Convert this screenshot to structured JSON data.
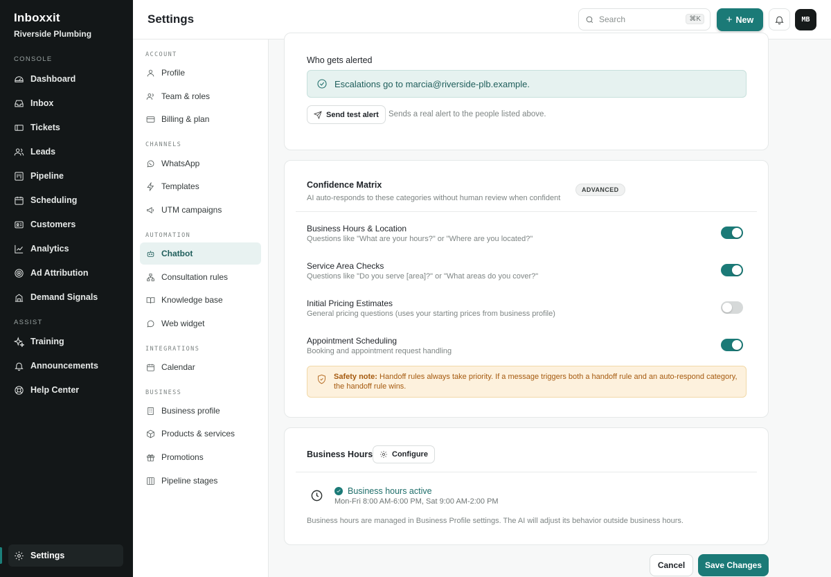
{
  "brand": {
    "name": "Inboxxit",
    "workspace": "Riverside Plumbing"
  },
  "sidebar": {
    "console_label": "CONSOLE",
    "console_items": [
      {
        "label": "Dashboard",
        "icon": "gauge-icon"
      },
      {
        "label": "Inbox",
        "icon": "inbox-icon"
      },
      {
        "label": "Tickets",
        "icon": "ticket-icon"
      },
      {
        "label": "Leads",
        "icon": "users-icon"
      },
      {
        "label": "Pipeline",
        "icon": "kanban-icon"
      },
      {
        "label": "Scheduling",
        "icon": "calendar-icon"
      },
      {
        "label": "Customers",
        "icon": "id-card-icon"
      },
      {
        "label": "Analytics",
        "icon": "chart-line-icon"
      },
      {
        "label": "Ad Attribution",
        "icon": "target-icon"
      },
      {
        "label": "Demand Signals",
        "icon": "building-icon"
      }
    ],
    "assist_label": "ASSIST",
    "assist_items": [
      {
        "label": "Training",
        "icon": "sparkle-icon"
      },
      {
        "label": "Announcements",
        "icon": "bell-icon"
      },
      {
        "label": "Help Center",
        "icon": "lifebuoy-icon"
      }
    ],
    "settings_label": "Settings"
  },
  "header": {
    "title": "Settings",
    "search_placeholder": "Search",
    "search_shortcut": "⌘K",
    "new_label": "New",
    "avatar_initials": "MB"
  },
  "subnav": {
    "sections": [
      {
        "title": "ACCOUNT",
        "items": [
          "Profile",
          "Team & roles",
          "Billing & plan"
        ]
      },
      {
        "title": "CHANNELS",
        "items": [
          "WhatsApp",
          "Templates",
          "UTM campaigns"
        ]
      },
      {
        "title": "AUTOMATION",
        "items": [
          "Chatbot",
          "Consultation rules",
          "Knowledge base",
          "Web widget"
        ]
      },
      {
        "title": "INTEGRATIONS",
        "items": [
          "Calendar"
        ]
      },
      {
        "title": "BUSINESS",
        "items": [
          "Business profile",
          "Products & services",
          "Promotions",
          "Pipeline stages"
        ]
      }
    ],
    "active": "Chatbot"
  },
  "alerts": {
    "heading": "Who gets alerted",
    "escalation_text": "Escalations go to marcia@riverside-plb.example.",
    "test_button": "Send test alert",
    "test_hint": "Sends a real alert to the people listed above."
  },
  "confidence_matrix": {
    "title": "Confidence Matrix",
    "subtitle": "AI auto-responds to these categories without human review when confident",
    "badge": "ADVANCED",
    "rows": [
      {
        "title": "Business Hours & Location",
        "desc": "Questions like \"What are your hours?\" or \"Where are you located?\"",
        "enabled": true
      },
      {
        "title": "Service Area Checks",
        "desc": "Questions like \"Do you serve [area]?\" or \"What areas do you cover?\"",
        "enabled": true
      },
      {
        "title": "Initial Pricing Estimates",
        "desc": "General pricing questions (uses your starting prices from business profile)",
        "enabled": false
      },
      {
        "title": "Appointment Scheduling",
        "desc": "Booking and appointment request handling",
        "enabled": true
      }
    ],
    "safety_label": "Safety note:",
    "safety_text": "Handoff rules always take priority. If a message triggers both a handoff rule and an auto-respond category, the handoff rule wins."
  },
  "business_hours": {
    "title": "Business Hours",
    "configure_label": "Configure",
    "status": "Business hours active",
    "hours": "Mon-Fri 8:00 AM-6:00 PM, Sat 9:00 AM-2:00 PM",
    "note": "Business hours are managed in Business Profile settings. The AI will adjust its behavior outside business hours."
  },
  "footer": {
    "cancel_label": "Cancel",
    "save_label": "Save Changes"
  },
  "colors": {
    "accent": "#1b7a77",
    "sidebar_bg": "#131718",
    "safety_bg": "#fdf1dd",
    "safety_text": "#a55a0f"
  }
}
